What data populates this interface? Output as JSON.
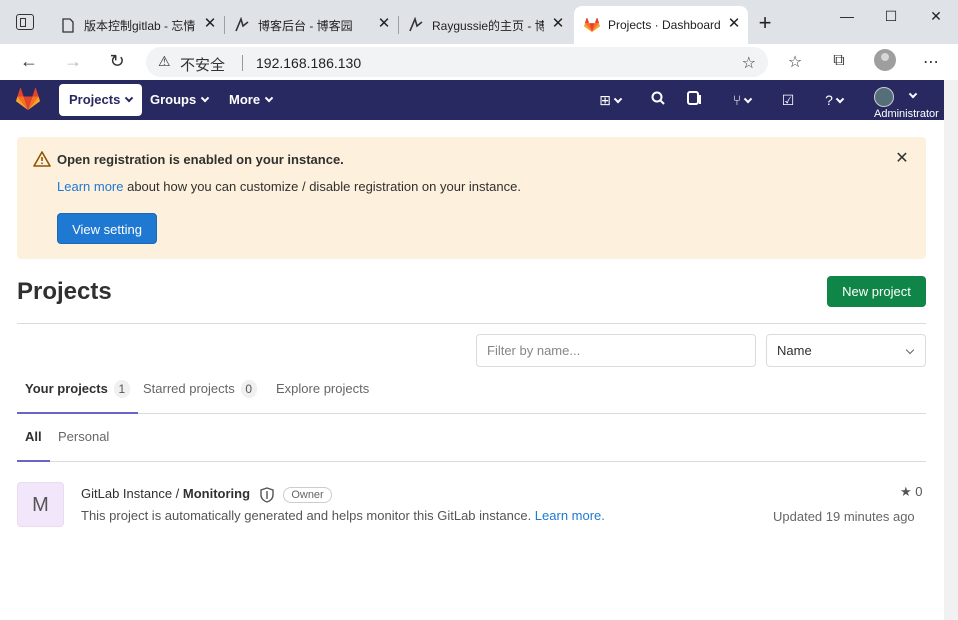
{
  "browser": {
    "tabs": [
      {
        "title": "版本控制gitlab - 忘情"
      },
      {
        "title": "博客后台 - 博客园"
      },
      {
        "title": "Raygussie的主页 - 博"
      },
      {
        "title": "Projects · Dashboard"
      }
    ],
    "address": {
      "security_label": "不安全",
      "url": "192.168.186.130"
    }
  },
  "gitlab_nav": {
    "items": [
      {
        "label": "Projects"
      },
      {
        "label": "Groups"
      },
      {
        "label": "More"
      }
    ],
    "user_name": "Administrator"
  },
  "banner": {
    "title": "Open registration is enabled on your instance.",
    "link_text": "Learn more",
    "body_text": " about how you can customize / disable registration on your instance.",
    "button_label": "View setting"
  },
  "page": {
    "title": "Projects",
    "new_project_label": "New project",
    "filter_placeholder": "Filter by name...",
    "sort_value": "Name"
  },
  "project_tabs": [
    {
      "label": "Your projects",
      "count": "1"
    },
    {
      "label": "Starred projects",
      "count": "0"
    },
    {
      "label": "Explore projects"
    }
  ],
  "scope_tabs": [
    {
      "label": "All"
    },
    {
      "label": "Personal"
    }
  ],
  "projects": [
    {
      "avatar_letter": "M",
      "namespace": "GitLab Instance / ",
      "name": "Monitoring",
      "role": "Owner",
      "description": "This project is automatically generated and helps monitor this GitLab instance. ",
      "description_link": "Learn more.",
      "stars": "0",
      "updated": "Updated 19 minutes ago"
    }
  ],
  "colors": {
    "nav_bg": "#292961",
    "banner_bg": "#fdf1dd",
    "primary": "#1f78d1",
    "success": "#108548",
    "tab_active_border": "#6666c4"
  }
}
